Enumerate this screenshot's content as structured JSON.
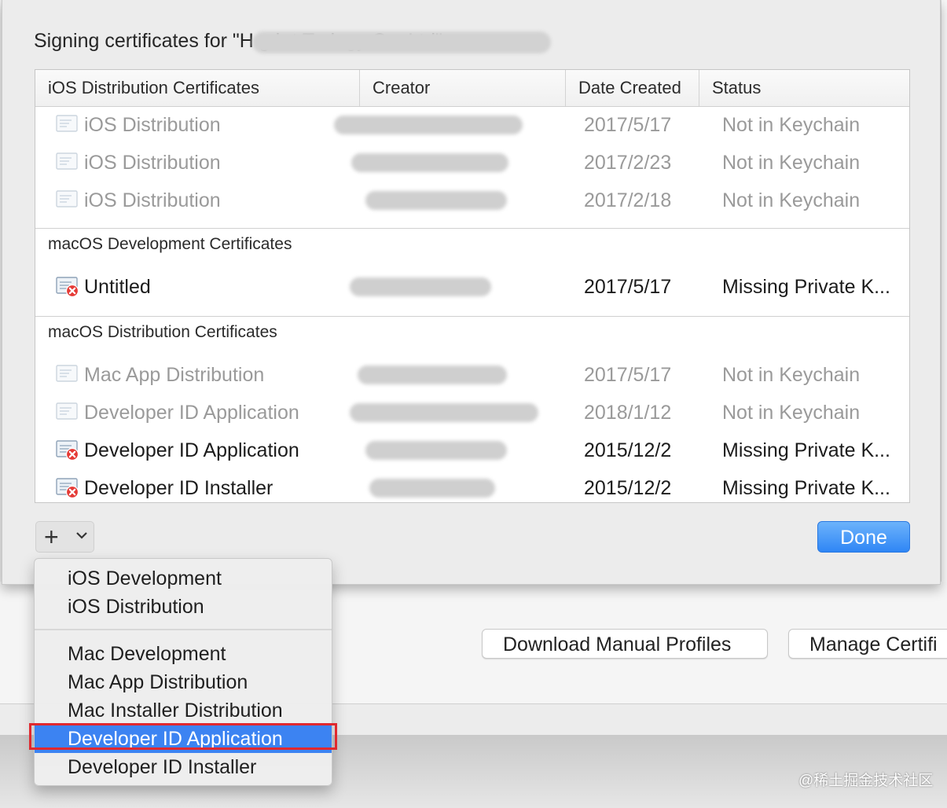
{
  "sheet": {
    "title": "Signing certificates for \"H  g   h    t         T      ology Co.,Ltd\":",
    "columns": [
      "iOS Distribution Certificates",
      "Creator",
      "Date Created",
      "Status"
    ],
    "sections": [
      {
        "title": "",
        "rows": [
          {
            "name": "iOS Distribution",
            "date": "2017/5/17",
            "status": "Not in Keychain",
            "state": "dim"
          },
          {
            "name": "iOS Distribution",
            "date": "2017/2/23",
            "status": "Not in Keychain",
            "state": "dim"
          },
          {
            "name": "iOS Distribution",
            "date": "2017/2/18",
            "status": "Not in Keychain",
            "state": "dim"
          }
        ]
      },
      {
        "title": "macOS Development Certificates",
        "rows": [
          {
            "name": "Untitled",
            "date": "2017/5/17",
            "status": "Missing Private K...",
            "state": "missing"
          }
        ]
      },
      {
        "title": "macOS Distribution Certificates",
        "rows": [
          {
            "name": "Mac App Distribution",
            "date": "2017/5/17",
            "status": "Not in Keychain",
            "state": "dim"
          },
          {
            "name": "Developer ID Application",
            "date": "2018/1/12",
            "status": "Not in Keychain",
            "state": "dim"
          },
          {
            "name": "Developer ID Application",
            "date": "2015/12/2",
            "status": "Missing Private K...",
            "state": "missing"
          },
          {
            "name": "Developer ID Installer",
            "date": "2015/12/2",
            "status": "Missing Private K...",
            "state": "missing"
          }
        ]
      }
    ],
    "add_symbol": "+",
    "done_label": "Done"
  },
  "menu": {
    "items": [
      {
        "label": "iOS Development"
      },
      {
        "label": "iOS Distribution"
      },
      {
        "label": "Mac Development"
      },
      {
        "label": "Mac App Distribution"
      },
      {
        "label": "Mac Installer Distribution"
      },
      {
        "label": "Developer ID Application",
        "selected": true
      },
      {
        "label": "Developer ID Installer"
      }
    ]
  },
  "background": {
    "download_profiles_label": "Download Manual Profiles",
    "manage_certificates_label": "Manage Certifi"
  },
  "watermark": "@稀土掘金技术社区",
  "colors": {
    "accent": "#3c83f2",
    "done_button": "#2f86f5",
    "highlight": "#e0282e",
    "dim_text": "#9a9a9a"
  }
}
